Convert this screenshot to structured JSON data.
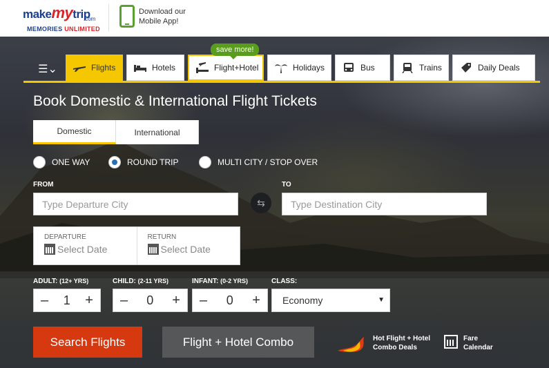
{
  "header": {
    "logo_word_make": "make",
    "logo_word_my": "my",
    "logo_word_trip": "trip",
    "logo_dotcom": ".com",
    "logo_tag_memories": "MEMORIES",
    "logo_tag_unlimited": "UNLIMITED",
    "app_promo": "Download our Mobile App!"
  },
  "nav": {
    "menu_glyph": "☰⌄",
    "tabs": [
      {
        "label": "Flights",
        "icon": "airplane-icon",
        "active": true
      },
      {
        "label": "Hotels",
        "icon": "bed-icon",
        "active": false
      },
      {
        "label": "Flight+Hotel",
        "icon": "flight-hotel-icon",
        "active": false
      },
      {
        "label": "Holidays",
        "icon": "palm-tree-icon",
        "active": false
      },
      {
        "label": "Bus",
        "icon": "bus-icon",
        "active": false
      },
      {
        "label": "Trains",
        "icon": "train-icon",
        "active": false
      },
      {
        "label": "Daily Deals",
        "icon": "tag-icon",
        "active": false
      }
    ],
    "badge": "save more!"
  },
  "booking": {
    "title": "Book Domestic & International Flight Tickets",
    "segments": [
      "Domestic",
      "International"
    ],
    "trip_types": [
      "ONE WAY",
      "ROUND TRIP",
      "MULTI CITY / STOP OVER"
    ],
    "selected_trip_type": "ROUND TRIP",
    "from_label": "FROM",
    "to_label": "TO",
    "from_placeholder": "Type Departure City",
    "to_placeholder": "Type Destination City",
    "swap_glyph": "⇆",
    "departure_label": "DEPARTURE",
    "return_label": "RETURN",
    "date_placeholder": "Select Date",
    "adult_label": "ADULT:",
    "adult_range": "(12+ YRS)",
    "child_label": "CHILD:",
    "child_range": "(2-11 YRS)",
    "infant_label": "INFANT:",
    "infant_range": "(0-2 YRS)",
    "class_label": "CLASS:",
    "adult_count": "1",
    "child_count": "0",
    "infant_count": "0",
    "minus": "–",
    "plus": "+",
    "class_value": "Economy",
    "caret": "▼",
    "search_button": "Search Flights",
    "combo_button": "Flight + Hotel Combo",
    "promo_combo": "Hot Flight + Hotel Combo Deals",
    "promo_fare": "Fare Calendar"
  },
  "colors": {
    "accent": "#f5c700",
    "search": "#d6380f",
    "combo": "#565758",
    "badge": "#5a9d1e"
  }
}
